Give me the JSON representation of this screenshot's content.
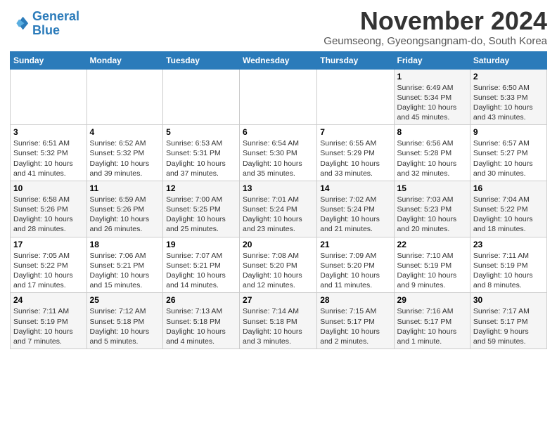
{
  "header": {
    "logo_line1": "General",
    "logo_line2": "Blue",
    "title": "November 2024",
    "subtitle": "Geumseong, Gyeongsangnm-do, South Korea"
  },
  "weekdays": [
    "Sunday",
    "Monday",
    "Tuesday",
    "Wednesday",
    "Thursday",
    "Friday",
    "Saturday"
  ],
  "rows": [
    [
      {
        "day": "",
        "info": ""
      },
      {
        "day": "",
        "info": ""
      },
      {
        "day": "",
        "info": ""
      },
      {
        "day": "",
        "info": ""
      },
      {
        "day": "",
        "info": ""
      },
      {
        "day": "1",
        "info": "Sunrise: 6:49 AM\nSunset: 5:34 PM\nDaylight: 10 hours\nand 45 minutes."
      },
      {
        "day": "2",
        "info": "Sunrise: 6:50 AM\nSunset: 5:33 PM\nDaylight: 10 hours\nand 43 minutes."
      }
    ],
    [
      {
        "day": "3",
        "info": "Sunrise: 6:51 AM\nSunset: 5:32 PM\nDaylight: 10 hours\nand 41 minutes."
      },
      {
        "day": "4",
        "info": "Sunrise: 6:52 AM\nSunset: 5:32 PM\nDaylight: 10 hours\nand 39 minutes."
      },
      {
        "day": "5",
        "info": "Sunrise: 6:53 AM\nSunset: 5:31 PM\nDaylight: 10 hours\nand 37 minutes."
      },
      {
        "day": "6",
        "info": "Sunrise: 6:54 AM\nSunset: 5:30 PM\nDaylight: 10 hours\nand 35 minutes."
      },
      {
        "day": "7",
        "info": "Sunrise: 6:55 AM\nSunset: 5:29 PM\nDaylight: 10 hours\nand 33 minutes."
      },
      {
        "day": "8",
        "info": "Sunrise: 6:56 AM\nSunset: 5:28 PM\nDaylight: 10 hours\nand 32 minutes."
      },
      {
        "day": "9",
        "info": "Sunrise: 6:57 AM\nSunset: 5:27 PM\nDaylight: 10 hours\nand 30 minutes."
      }
    ],
    [
      {
        "day": "10",
        "info": "Sunrise: 6:58 AM\nSunset: 5:26 PM\nDaylight: 10 hours\nand 28 minutes."
      },
      {
        "day": "11",
        "info": "Sunrise: 6:59 AM\nSunset: 5:26 PM\nDaylight: 10 hours\nand 26 minutes."
      },
      {
        "day": "12",
        "info": "Sunrise: 7:00 AM\nSunset: 5:25 PM\nDaylight: 10 hours\nand 25 minutes."
      },
      {
        "day": "13",
        "info": "Sunrise: 7:01 AM\nSunset: 5:24 PM\nDaylight: 10 hours\nand 23 minutes."
      },
      {
        "day": "14",
        "info": "Sunrise: 7:02 AM\nSunset: 5:24 PM\nDaylight: 10 hours\nand 21 minutes."
      },
      {
        "day": "15",
        "info": "Sunrise: 7:03 AM\nSunset: 5:23 PM\nDaylight: 10 hours\nand 20 minutes."
      },
      {
        "day": "16",
        "info": "Sunrise: 7:04 AM\nSunset: 5:22 PM\nDaylight: 10 hours\nand 18 minutes."
      }
    ],
    [
      {
        "day": "17",
        "info": "Sunrise: 7:05 AM\nSunset: 5:22 PM\nDaylight: 10 hours\nand 17 minutes."
      },
      {
        "day": "18",
        "info": "Sunrise: 7:06 AM\nSunset: 5:21 PM\nDaylight: 10 hours\nand 15 minutes."
      },
      {
        "day": "19",
        "info": "Sunrise: 7:07 AM\nSunset: 5:21 PM\nDaylight: 10 hours\nand 14 minutes."
      },
      {
        "day": "20",
        "info": "Sunrise: 7:08 AM\nSunset: 5:20 PM\nDaylight: 10 hours\nand 12 minutes."
      },
      {
        "day": "21",
        "info": "Sunrise: 7:09 AM\nSunset: 5:20 PM\nDaylight: 10 hours\nand 11 minutes."
      },
      {
        "day": "22",
        "info": "Sunrise: 7:10 AM\nSunset: 5:19 PM\nDaylight: 10 hours\nand 9 minutes."
      },
      {
        "day": "23",
        "info": "Sunrise: 7:11 AM\nSunset: 5:19 PM\nDaylight: 10 hours\nand 8 minutes."
      }
    ],
    [
      {
        "day": "24",
        "info": "Sunrise: 7:11 AM\nSunset: 5:19 PM\nDaylight: 10 hours\nand 7 minutes."
      },
      {
        "day": "25",
        "info": "Sunrise: 7:12 AM\nSunset: 5:18 PM\nDaylight: 10 hours\nand 5 minutes."
      },
      {
        "day": "26",
        "info": "Sunrise: 7:13 AM\nSunset: 5:18 PM\nDaylight: 10 hours\nand 4 minutes."
      },
      {
        "day": "27",
        "info": "Sunrise: 7:14 AM\nSunset: 5:18 PM\nDaylight: 10 hours\nand 3 minutes."
      },
      {
        "day": "28",
        "info": "Sunrise: 7:15 AM\nSunset: 5:17 PM\nDaylight: 10 hours\nand 2 minutes."
      },
      {
        "day": "29",
        "info": "Sunrise: 7:16 AM\nSunset: 5:17 PM\nDaylight: 10 hours\nand 1 minute."
      },
      {
        "day": "30",
        "info": "Sunrise: 7:17 AM\nSunset: 5:17 PM\nDaylight: 9 hours\nand 59 minutes."
      }
    ]
  ]
}
